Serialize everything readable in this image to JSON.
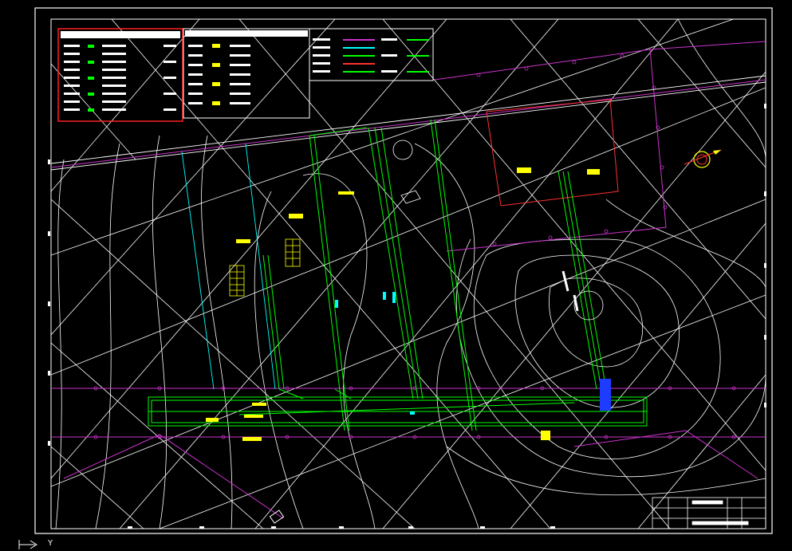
{
  "app": {
    "view": "model-space"
  },
  "colors": {
    "background": "#000000",
    "frame": "#ffffff",
    "contour": "#ffffff",
    "boundary": "#cc33cc",
    "pipe": "#00ff00",
    "road": "#00ffff",
    "label": "#ffff00",
    "table_border": "#ff2020",
    "building": "#ff3030"
  },
  "ucs": {
    "axis_label": "Y"
  },
  "labels": {
    "tag_a": "",
    "tag_b": "",
    "tag_c": "",
    "tag_d": "",
    "tag_e": "",
    "tag_f": "",
    "tag_g": "",
    "tag_h": "",
    "tag_i": "",
    "tag_j": ""
  },
  "icons": {
    "north_arrow": "north-arrow-icon",
    "ucs": "ucs-axis-icon"
  }
}
